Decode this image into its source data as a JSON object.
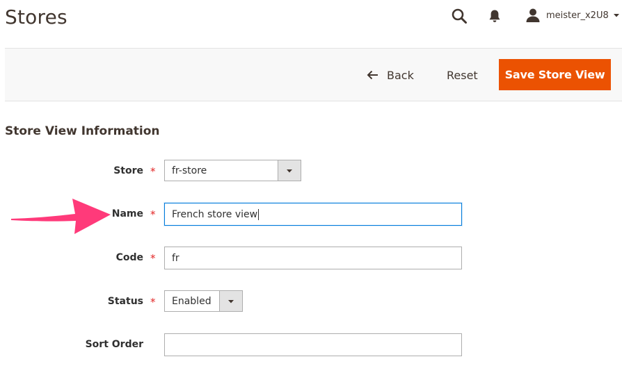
{
  "page": {
    "title": "Stores"
  },
  "header": {
    "user_name": "meister_x2U8",
    "icons": {
      "search": "search-icon",
      "notifications": "bell-icon",
      "user": "user-icon",
      "menu": "caret-down-icon"
    }
  },
  "actions": {
    "back_label": "Back",
    "reset_label": "Reset",
    "save_label": "Save Store View"
  },
  "section": {
    "title": "Store View Information"
  },
  "form": {
    "store": {
      "label": "Store",
      "value": "fr-store",
      "required_mark": "*"
    },
    "name": {
      "label": "Name",
      "value": "French store view",
      "required_mark": "*"
    },
    "code": {
      "label": "Code",
      "value": "fr",
      "required_mark": "*"
    },
    "status": {
      "label": "Status",
      "value": "Enabled",
      "required_mark": "*"
    },
    "sort_order": {
      "label": "Sort Order",
      "value": ""
    }
  },
  "colors": {
    "accent": "#eb5202",
    "annotation_arrow": "#ff3a7a",
    "focus_border": "#007bdb"
  }
}
